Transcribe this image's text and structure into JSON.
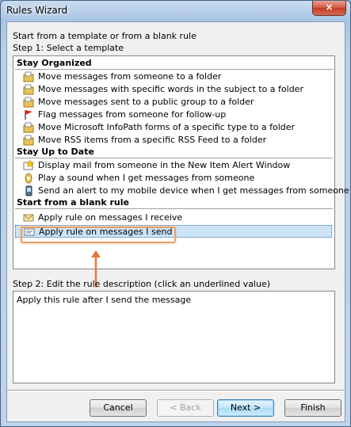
{
  "window": {
    "title": "Rules Wizard",
    "close_label": "×"
  },
  "intro_text": "Start from a template or from a blank rule",
  "step1_label": "Step 1: Select a template",
  "groups": [
    {
      "label": "Stay Organized",
      "items": [
        {
          "label": "Move messages from someone to a folder",
          "icon": "move-to-folder-icon"
        },
        {
          "label": "Move messages with specific words in the subject to a folder",
          "icon": "move-to-folder-icon"
        },
        {
          "label": "Move messages sent to a public group to a folder",
          "icon": "move-to-folder-icon"
        },
        {
          "label": "Flag messages from someone for follow-up",
          "icon": "flag-icon"
        },
        {
          "label": "Move Microsoft InfoPath forms of a specific type to a folder",
          "icon": "move-to-folder-icon"
        },
        {
          "label": "Move RSS items from a specific RSS Feed to a folder",
          "icon": "move-to-folder-icon"
        }
      ]
    },
    {
      "label": "Stay Up to Date",
      "items": [
        {
          "label": "Display mail from someone in the New Item Alert Window",
          "icon": "alert-window-icon"
        },
        {
          "label": "Play a sound when I get messages from someone",
          "icon": "sound-icon"
        },
        {
          "label": "Send an alert to my mobile device when I get messages from someone",
          "icon": "mobile-device-icon"
        }
      ]
    },
    {
      "label": "Start from a blank rule",
      "items": [
        {
          "label": "Apply rule on messages I receive",
          "icon": "envelope-icon"
        },
        {
          "label": "Apply rule on messages I send",
          "icon": "sent-message-icon",
          "selected": true
        }
      ]
    }
  ],
  "step2_label": "Step 2: Edit the rule description (click an underlined value)",
  "description_text": "Apply this rule after I send the message",
  "buttons": {
    "cancel": "Cancel",
    "back": "< Back",
    "next": "Next >",
    "finish": "Finish"
  },
  "colors": {
    "selection": "#cce4f7",
    "annotation": "#e07a3a"
  }
}
